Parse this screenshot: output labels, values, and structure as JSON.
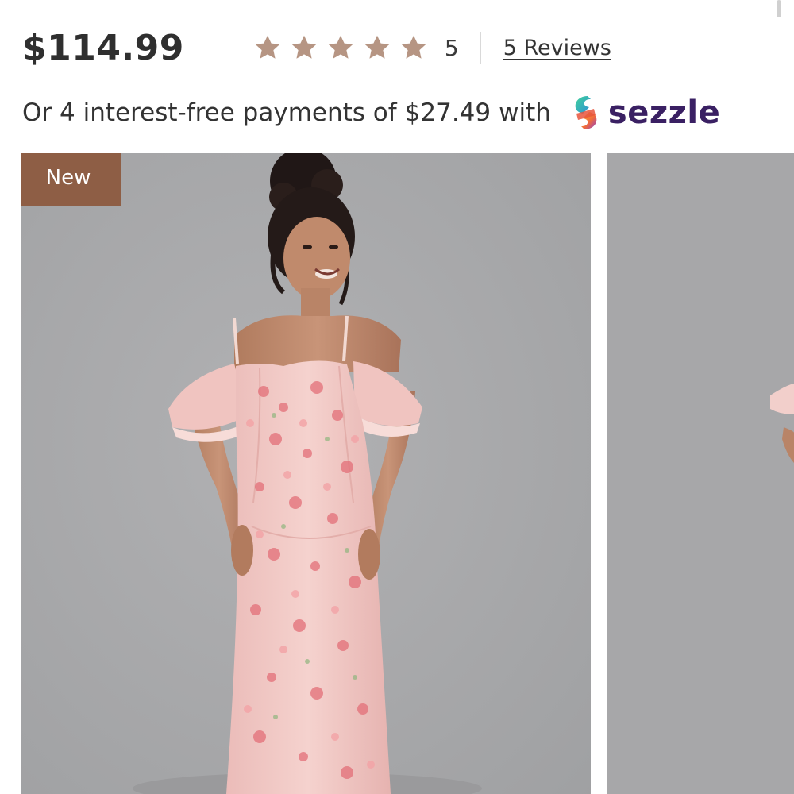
{
  "product": {
    "price": "$114.99",
    "rating": {
      "stars_filled": 5,
      "stars_total": 5,
      "value_label": "5",
      "reviews_label": "5 Reviews"
    },
    "payment": {
      "prefix": "Or 4 interest-free payments of",
      "amount": "$27.49",
      "suffix": "with",
      "provider": "sezzle"
    }
  },
  "gallery": {
    "badge": "New",
    "images": [
      {
        "icon": "model-in-floral-dress"
      },
      {
        "icon": "model-partial-next-image"
      }
    ]
  },
  "colors": {
    "star": "#b69583",
    "badge_bg": "#8e5e45",
    "photo_bg": "#a8a8aa",
    "sezzle_text": "#3a2063",
    "dress": "#f3c9c6"
  }
}
